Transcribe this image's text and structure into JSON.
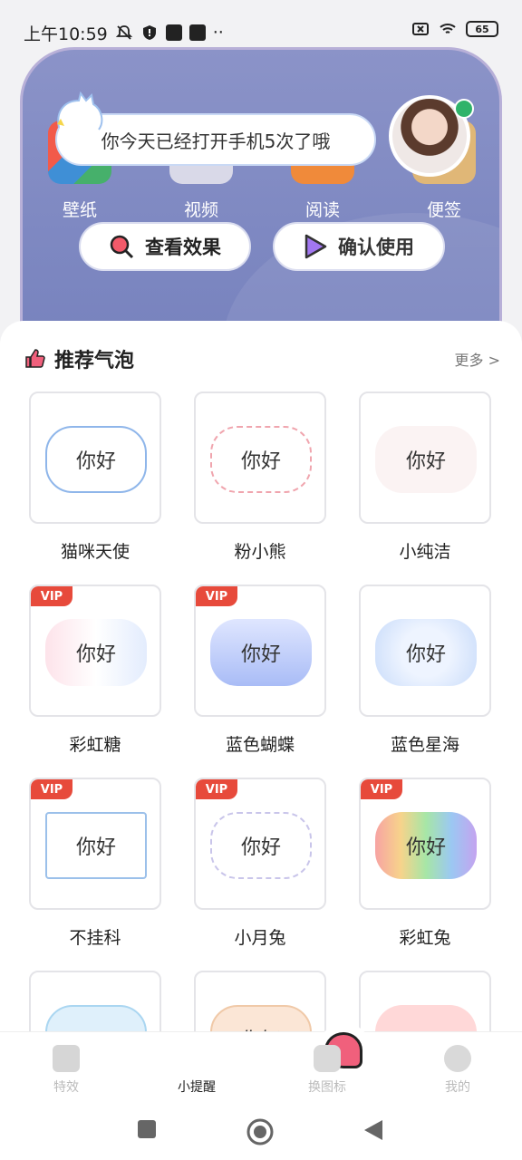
{
  "status_bar": {
    "time": "上午10:59",
    "extra": "··",
    "battery": "65"
  },
  "preview": {
    "bubble_text": "你今天已经打开手机5次了哦",
    "apps": [
      {
        "label": "壁纸",
        "color": "#3f8fd6"
      },
      {
        "label": "视频",
        "color": "#d9d9e8"
      },
      {
        "label": "阅读",
        "color": "#f08a3a"
      },
      {
        "label": "便签",
        "color": "#e0b777"
      }
    ],
    "buttons": {
      "preview_label": "查看效果",
      "confirm_label": "确认使用"
    }
  },
  "section": {
    "title": "推荐气泡",
    "more": "更多 >"
  },
  "bubbles": [
    {
      "name": "猫咪天使",
      "text": "你好",
      "vip": ""
    },
    {
      "name": "粉小熊",
      "text": "你好",
      "vip": ""
    },
    {
      "name": "小纯洁",
      "text": "你好",
      "vip": ""
    },
    {
      "name": "彩虹糖",
      "text": "你好",
      "vip": "VIP"
    },
    {
      "name": "蓝色蝴蝶",
      "text": "你好",
      "vip": "VIP"
    },
    {
      "name": "蓝色星海",
      "text": "你好",
      "vip": ""
    },
    {
      "name": "不挂科",
      "text": "你好",
      "vip": "VIP"
    },
    {
      "name": "小月兔",
      "text": "你好",
      "vip": "VIP"
    },
    {
      "name": "彩虹兔",
      "text": "你好",
      "vip": "VIP"
    },
    {
      "name": "",
      "text": "",
      "vip": ""
    },
    {
      "name": "",
      "text": "你好",
      "vip": ""
    },
    {
      "name": "",
      "text": "",
      "vip": ""
    }
  ],
  "bottom_nav": [
    {
      "label": "特效",
      "icon": "sparkle-icon"
    },
    {
      "label": "小提醒",
      "icon": "bubble-icon"
    },
    {
      "label": "换图标",
      "icon": "icons-icon"
    },
    {
      "label": "我的",
      "icon": "profile-icon"
    }
  ],
  "colors": {
    "accent": "#f0607c",
    "vip": "#e74a3b"
  }
}
